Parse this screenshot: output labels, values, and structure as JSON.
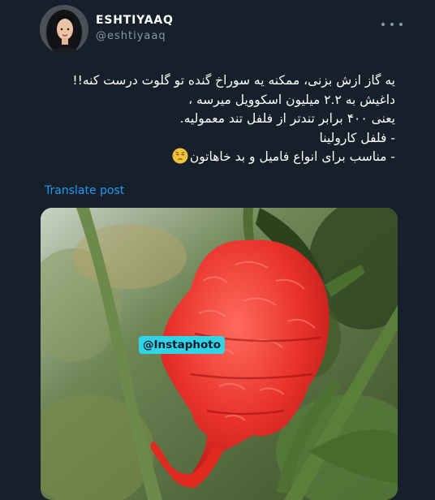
{
  "user": {
    "display_name": "ESHTIYAAQ",
    "handle": "@eshtiyaaq"
  },
  "tweet": {
    "lines": [
      "یه گاز ازش بزنی، ممکنه یه سوراخ گنده تو گلوت درست کنه!!",
      "داغیش به ۲.۲ میلیون اسکوویل میرسه ،",
      "یعنی ۴۰۰ برابر تندتر از فلفل تند معمولیه.",
      "- فلفل کارولینا",
      "- مناسب برای انواع فامیل و بد خاهاتون"
    ],
    "emoji_icon": "pensive-face-emoji",
    "translate_label": "Translate post"
  },
  "media": {
    "watermark": "@Instaphoto",
    "subject_icon": "red-chili-pepper-photo"
  },
  "icons": {
    "more": "more-horizontal-icon"
  },
  "colors": {
    "background": "#15202b",
    "link": "#1d9bf0",
    "secondary_text": "#8899a6",
    "watermark_bg": "#2fd5e6",
    "pepper": "#e8322b"
  }
}
